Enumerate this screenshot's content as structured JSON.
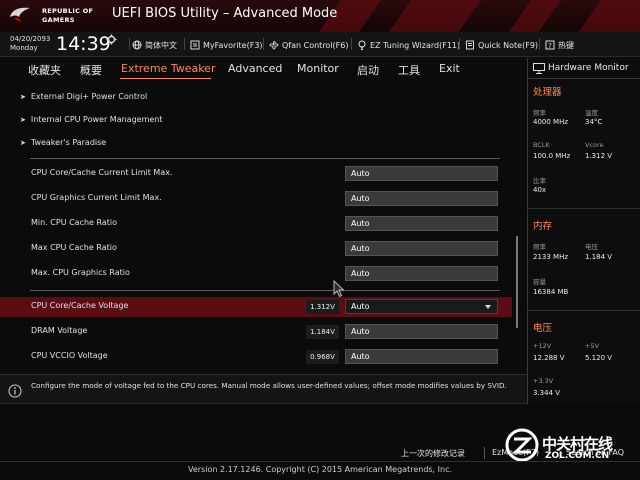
{
  "window": {
    "brand_line1": "REPUBLIC OF",
    "brand_line2": "GAMERS",
    "title": "UEFI BIOS Utility – Advanced Mode"
  },
  "clock": {
    "date": "04/20/2093",
    "day": "Monday",
    "time": "14:39"
  },
  "toolbar": {
    "language": "简体中文",
    "myfavorite": "MyFavorite(F3)",
    "qfan": "Qfan Control(F6)",
    "ez_tuning": "EZ Tuning Wizard(F11)",
    "quick_note": "Quick Note(F9)",
    "hotkeys": "热键"
  },
  "menu": {
    "tabs": [
      "收藏夹",
      "概要",
      "Extreme Tweaker",
      "Advanced",
      "Monitor",
      "启动",
      "工具",
      "Exit"
    ],
    "active_index": 2
  },
  "panel": {
    "nav_items": [
      "External Digi+ Power Control",
      "Internal CPU Power Management",
      "Tweaker's Paradise"
    ],
    "settings": [
      {
        "label": "CPU Core/Cache Current Limit Max.",
        "value": "Auto"
      },
      {
        "label": "CPU Graphics Current Limit Max.",
        "value": "Auto"
      },
      {
        "label": "Min. CPU Cache Ratio",
        "value": "Auto"
      },
      {
        "label": "Max CPU Cache Ratio",
        "value": "Auto"
      },
      {
        "label": "Max. CPU Graphics Ratio",
        "value": "Auto"
      }
    ],
    "voltages": [
      {
        "label": "CPU Core/Cache Voltage",
        "reading": "1.312V",
        "value": "Auto",
        "selected": true
      },
      {
        "label": "DRAM Voltage",
        "reading": "1.184V",
        "value": "Auto"
      },
      {
        "label": "CPU VCCIO Voltage",
        "reading": "0.968V",
        "value": "Auto"
      }
    ]
  },
  "hw_monitor": {
    "title": "Hardware Monitor",
    "cpu": {
      "section": "处理器",
      "freq_label": "频率",
      "freq": "4000 MHz",
      "temp_label": "温度",
      "temp": "34°C",
      "bclk_label": "BCLK",
      "bclk": "100.0 MHz",
      "vcore_label": "Vcore",
      "vcore": "1.312 V",
      "ratio_label": "比率",
      "ratio": "40x"
    },
    "memory": {
      "section": "内存",
      "freq_label": "频率",
      "freq": "2133 MHz",
      "volt_label": "电压",
      "volt": "1.184 V",
      "cap_label": "容量",
      "cap": "16384 MB"
    },
    "voltage": {
      "section": "电压",
      "v12_label": "+12V",
      "v12": "12.288 V",
      "v5_label": "+5V",
      "v5": "5.120 V",
      "v33_label": "+3.3V",
      "v33": "3.344 V"
    }
  },
  "help": {
    "text": "Configure the mode of voltage fed to the CPU cores. Manual mode allows user-defined values; offset mode modifies values by SVID."
  },
  "bottom": {
    "last_modified": "上一次的修改记录",
    "ezmode": "EzMode(F7)",
    "search": "Search on FAQ",
    "footer": "Version 2.17.1246. Copyright (C) 2015 American Megatrends, Inc."
  },
  "watermark": {
    "line1": "中关村在线",
    "line2": "ZOL.COM.CN"
  },
  "colors": {
    "accent": "#ff8a4c",
    "selection": "#5a0d13",
    "title_red": "#6e0d12"
  }
}
